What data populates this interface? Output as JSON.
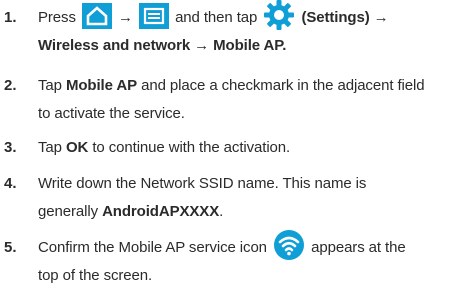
{
  "steps": [
    {
      "num": "1.",
      "line1_pre": "Press",
      "arrow1": "→",
      "line1_mid": "and then tap",
      "line1_post": "(Settings) →",
      "line2": "Wireless and network → Mobile AP."
    },
    {
      "num": "2.",
      "l1_pre": "Tap",
      "l1_bold": "Mobile AP",
      "l1_post": "and place a checkmark in the adjacent field",
      "l2": "to activate the service."
    },
    {
      "num": "3.",
      "l1_pre": "Tap",
      "l1_bold": "OK",
      "l1_post": "to continue with the activation."
    },
    {
      "num": "4.",
      "l1": "Write down the Network SSID name. This name is",
      "l2_pre": "generally",
      "l2_bold": "AndroidAPXXXX",
      "l2_post": "."
    },
    {
      "num": "5.",
      "l1_pre": "Confirm the Mobile AP service icon",
      "l1_post": "appears at the",
      "l2": "top of the screen."
    }
  ],
  "icons": {
    "home_key": "home-icon",
    "menu_key": "menu-icon",
    "settings": "gear-icon",
    "mobile_ap": "wifi-hotspot-icon",
    "key_color": "#0f9ed5"
  }
}
